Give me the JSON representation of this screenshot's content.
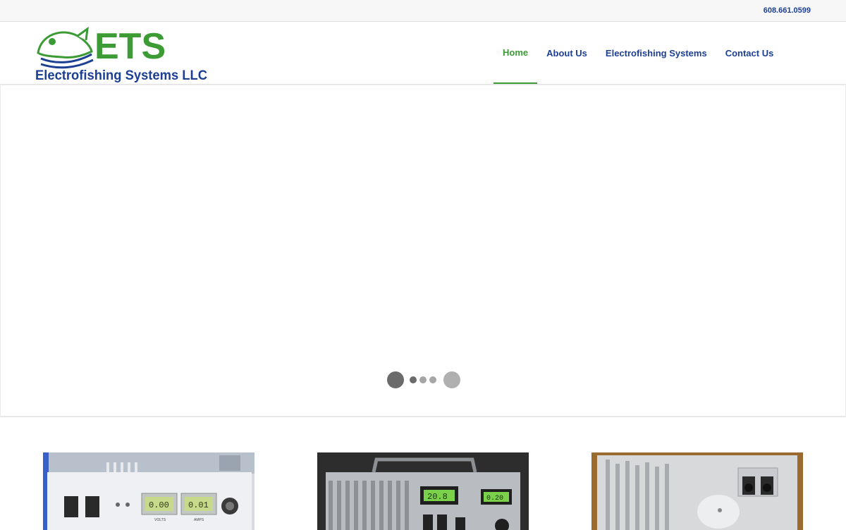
{
  "topbar": {
    "phone": "608.661.0599"
  },
  "logo": {
    "wordmark": "ETS",
    "tagline": "Electrofishing Systems LLC"
  },
  "nav": {
    "items": [
      {
        "label": "Home",
        "active": true
      },
      {
        "label": "About Us",
        "active": false
      },
      {
        "label": "Electrofishing Systems",
        "active": false
      },
      {
        "label": "Contact Us",
        "active": false
      }
    ]
  },
  "thumbs": {
    "left": {
      "display_volts": "0.00",
      "display_amps": "0.01",
      "label_volts": "VOLTS",
      "label_amps": "AMPS"
    },
    "middle": {
      "display_1": "20.8",
      "display_2": "0.20"
    }
  },
  "colors": {
    "brand_blue": "#1c3f94",
    "brand_green": "#3d9b35",
    "active_nav": "#3d9b35"
  }
}
